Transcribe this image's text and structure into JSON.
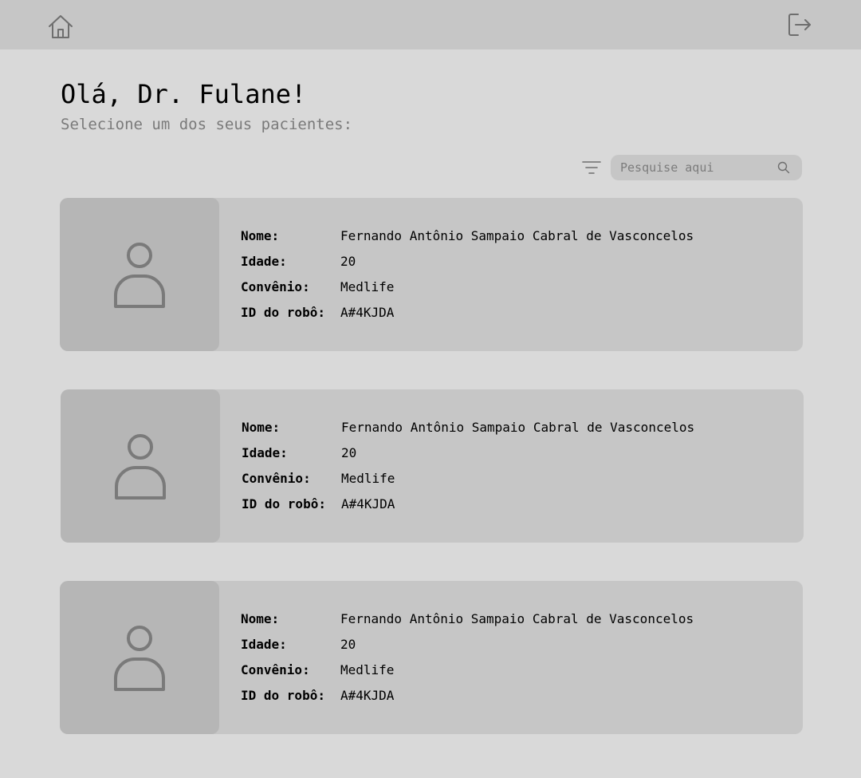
{
  "header": {
    "home_icon": "home-icon",
    "logout_icon": "logout-icon"
  },
  "main": {
    "greeting": "Olá, Dr. Fulane!",
    "subtitle": "Selecione um dos seus pacientes:"
  },
  "toolbar": {
    "filter_icon": "filter-icon",
    "search_placeholder": "Pesquise aqui",
    "search_value": "",
    "search_icon": "search-icon"
  },
  "labels": {
    "name": "Nome:",
    "age": "Idade:",
    "insurance": "Convênio:",
    "robot_id": "ID do robô:"
  },
  "patients": [
    {
      "avatar_icon": "user-icon",
      "name": "Fernando Antônio Sampaio Cabral de Vasconcelos",
      "age": "20",
      "insurance": "Medlife",
      "robot_id": "A#4KJDA"
    },
    {
      "avatar_icon": "user-icon",
      "name": "Fernando Antônio Sampaio Cabral de Vasconcelos",
      "age": "20",
      "insurance": "Medlife",
      "robot_id": "A#4KJDA"
    },
    {
      "avatar_icon": "user-icon",
      "name": "Fernando Antônio Sampaio Cabral de Vasconcelos",
      "age": "20",
      "insurance": "Medlife",
      "robot_id": "A#4KJDA"
    }
  ],
  "colors": {
    "background": "#d9d9d9",
    "topbar": "#c6c6c6",
    "card": "#c6c6c6",
    "photo": "#b6b6b6",
    "icon": "#7a7a7a",
    "subtitle": "#7a7a7a"
  }
}
